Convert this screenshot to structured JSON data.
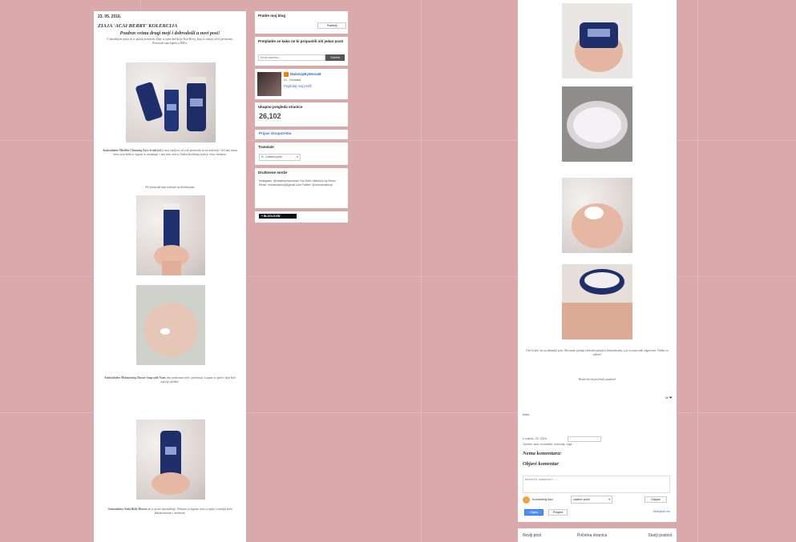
{
  "post": {
    "date": "23. 05. 2016.",
    "title": "ZIAJA 'ACAI BERRY' KOLEKCIJA",
    "greeting": "Pozdrav svima drugi moji i dobrodošli u novi post!",
    "intro": "U današnjem postu ću ti opisati proizvode Ziaje iz njene kolekcije Acai Berry, koja se sastoji od tri proizvoda. Proizvode sam kupila u DM-u.",
    "section1_title": "Antioxidative Micellar Cleansing Face Scrub Gel",
    "section1_body": "je moj omiljeni, od svih proizvoda iz ove kolekcije. Gel ima divan miris acai bobica, lagano se razmazuje i ima sitne zrnca. Nakon korištenja koža je čista i mekana.",
    "section1_note": "Ovi proizvodi nisu testirani na životinjama.",
    "section2_title": "Antioxidative Moisturising Shower Soap with Notes",
    "section2_body": "ima prekrasan miris i pakiranje. Lagano se pjeni i daje koži osjećaj svježine.",
    "section3_title": "Antioxidative Satin Body Mousse",
    "section3_body": "mi je pravo iznenađenje. Tekstura je lagana, brzo se upija i ostavlja kožu hidratiziranom i mirisnom."
  },
  "sidebar": {
    "follow": {
      "title": "Pratite moj blog",
      "button": "Pratitelji"
    },
    "subscribe": {
      "title": "Pretplatite se kako ne bi propustili niti jedan post!",
      "placeholder": "Email address...",
      "button": "Submit"
    },
    "profile": {
      "name": "MakeUpByMonaM",
      "location": "21 , Hrvatska",
      "link": "Pogledaj moj profil"
    },
    "views": {
      "title": "Ukupno pregleda stranice",
      "count": "26,102"
    },
    "report": {
      "link": "Prijavi zloupotrebu"
    },
    "translate": {
      "title": "Translate",
      "select": "Odaberi jezik"
    },
    "social": {
      "title": "Društvene mreže",
      "text": "Instagram: @makeupbymonam YouTube: MakeUp by Mona Email: monamakeup@gmail.com Twitter: @monamakeup"
    },
    "bloglovin": {
      "label": "BLOGLOVIN'"
    }
  },
  "post2": {
    "closing": "Ovo bi bilo sve za današnji post. Ako imate pitanja slobodno pitajte u komentarima, a ja ću vam rado odgovoriti. Vidimo se uskoro!",
    "closing2": "Hvala što ste pročitali, pozdrav!",
    "signature": "M ❤",
    "author_line": "Autor",
    "meta_date": "u srijedu, 25. 2016.",
    "labels": "Oznake: acai, kozmetika, recenzija, ziaja",
    "no_comments": "Nema komentara:",
    "post_comment": "Objavi komentar",
    "comment_placeholder": "Unesite komentar...",
    "comment_as_label": "Komentiraj kao:",
    "comment_as_value": "odaberi profil",
    "logout": "Odjava",
    "publish": "Objavi",
    "preview": "Pregled",
    "notify": "Obavijesti me"
  },
  "footer": {
    "newer": "Noviji post",
    "home": "Početna stranica",
    "older": "Stariji postovi"
  }
}
